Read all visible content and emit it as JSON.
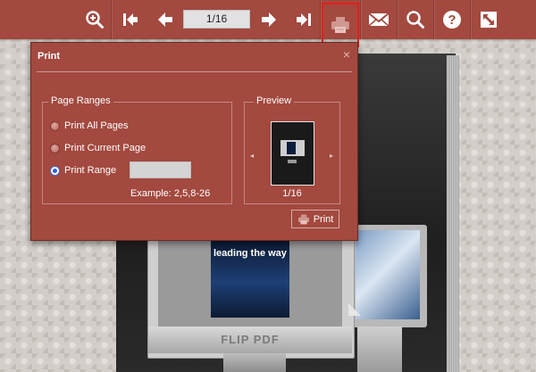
{
  "toolbar": {
    "page_indicator": "1/16",
    "buttons": [
      {
        "name": "zoom-in",
        "icon": "zoom-in-icon"
      },
      {
        "name": "first-page",
        "icon": "skip-to-start-icon"
      },
      {
        "name": "previous-page",
        "icon": "arrow-left-icon"
      },
      {
        "name": "next-page",
        "icon": "arrow-right-icon"
      },
      {
        "name": "last-page",
        "icon": "skip-to-end-icon"
      },
      {
        "name": "print",
        "icon": "printer-icon",
        "active": true
      },
      {
        "name": "email",
        "icon": "envelope-icon"
      },
      {
        "name": "search",
        "icon": "search-icon"
      },
      {
        "name": "help",
        "icon": "help-icon"
      },
      {
        "name": "fullscreen",
        "icon": "fullscreen-icon"
      }
    ]
  },
  "print_dialog": {
    "title": "Print",
    "close_symbol": "×",
    "page_ranges": {
      "label": "Page Ranges",
      "options": [
        {
          "label": "Print All Pages",
          "checked": false
        },
        {
          "label": "Print Current Page",
          "checked": false
        },
        {
          "label": "Print Range",
          "checked": true
        }
      ],
      "range_value": "",
      "example": "Example: 2,5,8-26"
    },
    "preview": {
      "label": "Preview",
      "page": "1/16",
      "prev_symbol": "◂",
      "next_symbol": "▸"
    },
    "print_button_label": "Print"
  },
  "book": {
    "magazine_headline": "leading the way",
    "brand": "FLIP PDF"
  },
  "colors": {
    "toolbar_bg": "#a3493f",
    "dialog_bg": "#a3493f",
    "highlight": "#e0201a"
  }
}
